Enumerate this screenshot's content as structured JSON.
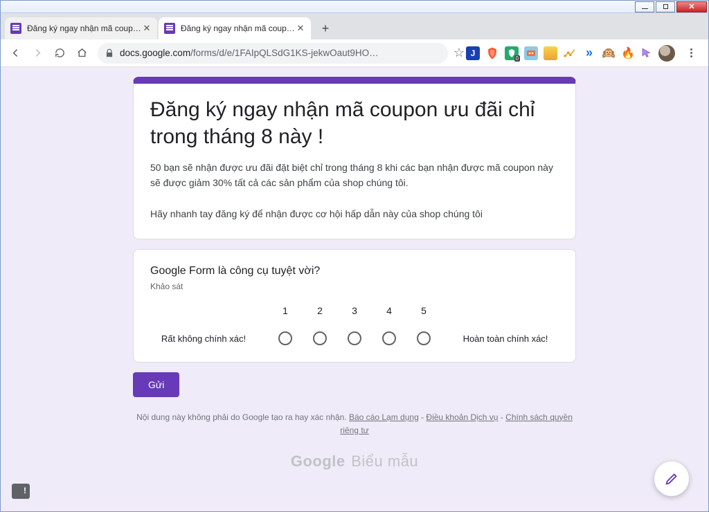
{
  "window": {
    "btn_min": "—",
    "btn_max": "▢",
    "btn_close": "✕"
  },
  "tabs": {
    "t0_title": "Đăng ký ngay nhận mã coupon ...",
    "t1_title": "Đăng ký ngay nhận mã coupon u...",
    "new_tab": "+"
  },
  "toolbar": {
    "url_domain": "docs.google.com",
    "url_path": "/forms/d/e/1FAIpQLSdG1KS-jekwOaut9HO…",
    "star": "☆",
    "ext_j": "J",
    "ext_double_arrow": "»",
    "ext_emoji": "🙉",
    "ext_fire": "🔥"
  },
  "form": {
    "title": "Đăng ký ngay nhận mã coupon ưu đãi chỉ trong tháng 8 này !",
    "desc": "50 bạn sẽ nhận được ưu đãi đặt biệt chỉ trong tháng 8 khi các bạn nhận được mã coupon này sẽ được giảm 30% tất cả các sản phẩm của shop chúng tôi.\n\nHãy nhanh tay đăng ký để nhận được cơ hội hấp dẫn này của shop chúng tôi",
    "question": "Google Form là công cụ tuyệt vời?",
    "question_sub": "Khảo sát",
    "scale_low": "Rất không chính xác!",
    "scale_high": "Hoàn toàn chính xác!",
    "scale_1": "1",
    "scale_2": "2",
    "scale_3": "3",
    "scale_4": "4",
    "scale_5": "5",
    "submit": "Gửi"
  },
  "footer": {
    "disclaimer_prefix": "Nội dung này không phải do Google tạo ra hay xác nhận. ",
    "link_abuse": "Báo cáo Lạm dụng",
    "sep": " - ",
    "link_terms": "Điều khoản Dịch vụ",
    "link_privacy": "Chính sách quyền riêng tư",
    "brand_google": "Google",
    "brand_forms": " Biểu mẫu"
  },
  "fb_bubble": "!"
}
